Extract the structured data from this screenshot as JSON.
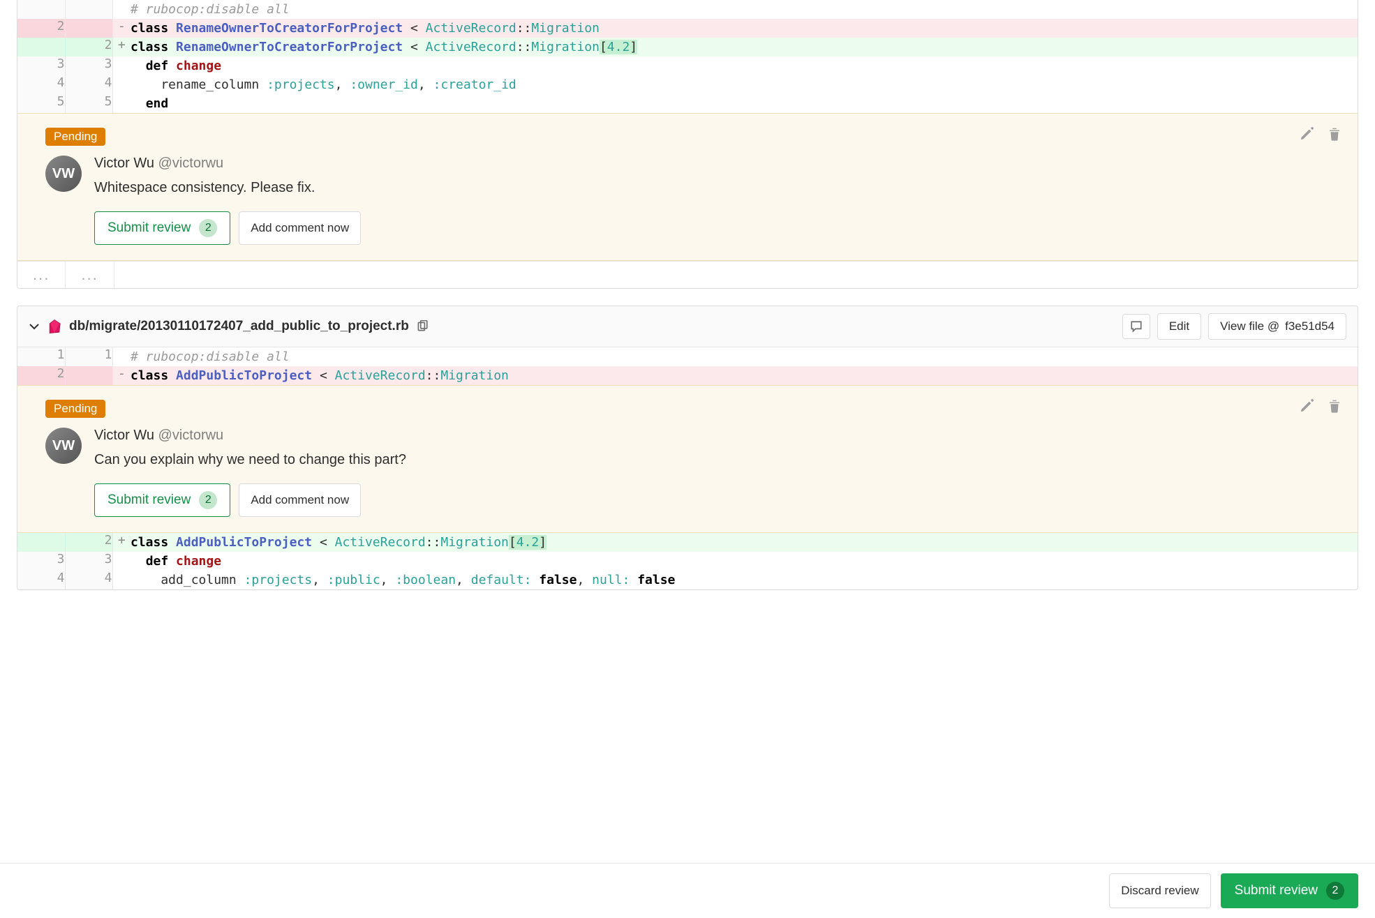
{
  "icons": {
    "chevron_down": "chevron-down",
    "ruby": "ruby",
    "copy": "copy",
    "comment": "comment",
    "pencil": "pencil",
    "trash": "trash"
  },
  "labels": {
    "edit": "Edit",
    "view_file_prefix": "View file @ ",
    "submit_review": "Submit review",
    "add_comment_now": "Add comment now",
    "discard_review": "Discard review",
    "pending": "Pending",
    "expand": "..."
  },
  "file1": {
    "lines": [
      {
        "type": "cmt",
        "old": "",
        "new": "",
        "g": " ",
        "html": "<span class='tk-com'># rubocop:disable all</span>"
      },
      {
        "type": "del",
        "old": "2",
        "new": "",
        "g": "-",
        "html": "<span class='tk-kw'>class</span> <span class='tk-cls'>RenameOwnerToCreatorForProject</span> &lt; <span class='tk-ns'>ActiveRecord</span>::<span class='tk-ns'>Migration</span>"
      },
      {
        "type": "add",
        "old": "",
        "new": "2",
        "g": "+",
        "html": "<span class='tk-kw'>class</span> <span class='tk-cls'>RenameOwnerToCreatorForProject</span> &lt; <span class='tk-ns'>ActiveRecord</span>::<span class='tk-ns'>Migration</span><span class='hl-add'>[<span class='tk-num'>4.2</span>]</span>"
      },
      {
        "type": "ctx",
        "old": "3",
        "new": "3",
        "g": " ",
        "html": "  <span class='tk-kw'>def</span> <span class='tk-defname'>change</span>"
      },
      {
        "type": "ctx",
        "old": "4",
        "new": "4",
        "g": " ",
        "html": "    rename_column <span class='tk-sym'>:projects</span>, <span class='tk-sym'>:owner_id</span>, <span class='tk-sym'>:creator_id</span>"
      },
      {
        "type": "ctx",
        "old": "5",
        "new": "5",
        "g": " ",
        "html": "  <span class='tk-kw'>end</span>"
      }
    ]
  },
  "file2": {
    "path": "db/migrate/20130110172407_add_public_to_project.rb",
    "view_sha": "f3e51d54",
    "lines_a": [
      {
        "type": "ctx",
        "old": "1",
        "new": "1",
        "g": " ",
        "html": "<span class='tk-com'># rubocop:disable all</span>"
      },
      {
        "type": "del",
        "old": "2",
        "new": "",
        "g": "-",
        "html": "<span class='tk-kw'>class</span> <span class='tk-cls'>AddPublicToProject</span> &lt; <span class='tk-ns'>ActiveRecord</span>::<span class='tk-ns'>Migration</span>"
      }
    ],
    "lines_b": [
      {
        "type": "add",
        "old": "",
        "new": "2",
        "g": "+",
        "html": "<span class='tk-kw'>class</span> <span class='tk-cls'>AddPublicToProject</span> &lt; <span class='tk-ns'>ActiveRecord</span>::<span class='tk-ns'>Migration</span><span class='hl-add'>[<span class='tk-num'>4.2</span>]</span>"
      },
      {
        "type": "ctx",
        "old": "3",
        "new": "3",
        "g": " ",
        "html": "  <span class='tk-kw'>def</span> <span class='tk-defname'>change</span>"
      },
      {
        "type": "ctx",
        "old": "4",
        "new": "4",
        "g": " ",
        "html": "    add_column <span class='tk-sym'>:projects</span>, <span class='tk-sym'>:public</span>, <span class='tk-sym'>:boolean</span>, <span class='tk-sym'>default:</span> <span class='tk-kw'>false</span>, <span class='tk-sym'>null:</span> <span class='tk-kw'>false</span>"
      }
    ]
  },
  "comment1": {
    "author_name": "Victor Wu",
    "author_handle": "@victorwu",
    "avatar_initials": "VW",
    "body": "Whitespace consistency. Please fix.",
    "review_count": "2"
  },
  "comment2": {
    "author_name": "Victor Wu",
    "author_handle": "@victorwu",
    "avatar_initials": "VW",
    "body": "Can you explain why we need to change this part?",
    "review_count": "2"
  },
  "bottom_bar": {
    "review_count": "2"
  }
}
